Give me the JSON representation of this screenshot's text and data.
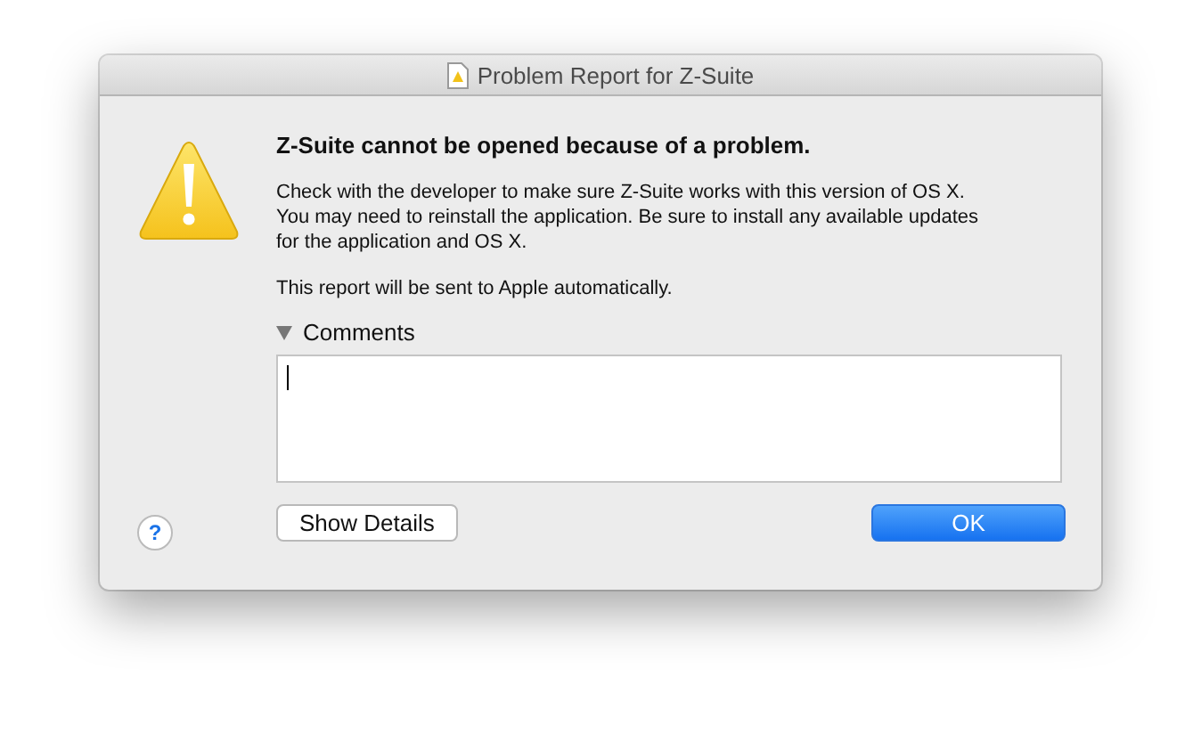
{
  "window": {
    "title": "Problem Report for Z-Suite"
  },
  "heading": "Z-Suite cannot be opened because of a problem.",
  "message": [
    "Check with the developer to make sure Z-Suite works with this version of OS X.",
    "You may need to reinstall the application. Be sure to install any available updates",
    "for the application and OS X."
  ],
  "note": "This report will be sent to Apple automatically.",
  "comments": {
    "label": "Comments",
    "expanded": true
  },
  "help": "?",
  "buttons": [
    {
      "label": "Show Details",
      "kind": "secondary"
    },
    {
      "label": "OK",
      "kind": "default"
    }
  ]
}
